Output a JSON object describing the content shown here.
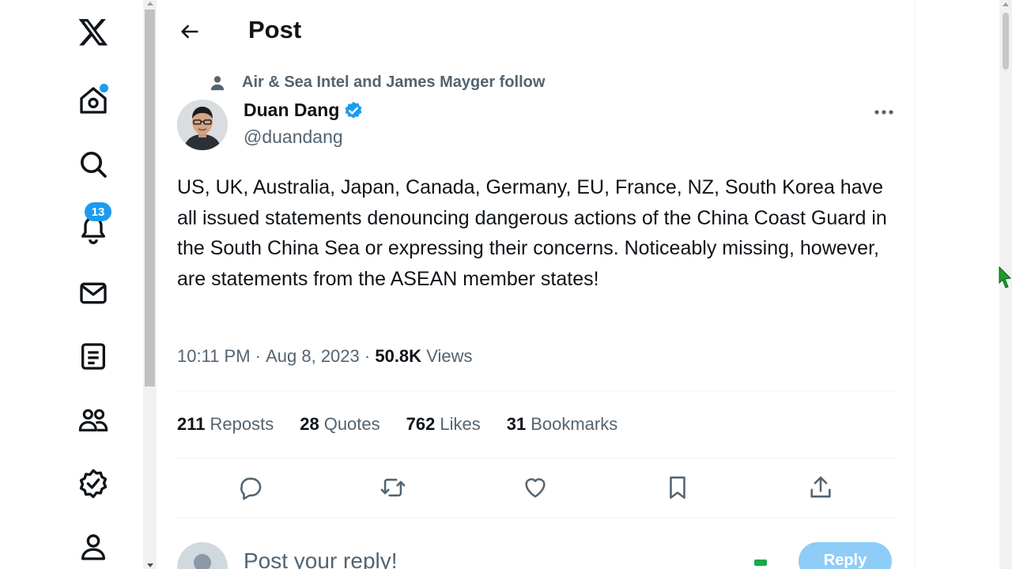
{
  "header": {
    "title": "Post",
    "back_label": "Back"
  },
  "nav": {
    "items": [
      {
        "name": "logo"
      },
      {
        "name": "home"
      },
      {
        "name": "explore"
      },
      {
        "name": "notifications",
        "badge": "13"
      },
      {
        "name": "messages"
      },
      {
        "name": "lists"
      },
      {
        "name": "communities"
      },
      {
        "name": "verified"
      },
      {
        "name": "profile"
      }
    ]
  },
  "post": {
    "social_context": "Air & Sea Intel and James Mayger follow",
    "author": {
      "name": "Duan Dang",
      "handle": "@duandang",
      "verified": true
    },
    "text": "US, UK, Australia, Japan, Canada, Germany, EU, France, NZ, South Korea have all issued statements denouncing dangerous actions of the China Coast Guard in the South China Sea or expressing their concerns. Noticeably missing, however, are statements from the ASEAN member states!",
    "time": "10:11 PM",
    "separator": " · ",
    "date": "Aug 8, 2023",
    "views_count": "50.8K",
    "views_label": "Views",
    "stats": [
      {
        "count": "211",
        "label": "Reposts"
      },
      {
        "count": "28",
        "label": "Quotes"
      },
      {
        "count": "762",
        "label": "Likes"
      },
      {
        "count": "31",
        "label": "Bookmarks"
      }
    ]
  },
  "reply": {
    "placeholder": "Post your reply!",
    "button_label": "Reply"
  },
  "colors": {
    "accent": "#1d9bf0",
    "secondary_text": "#536471",
    "primary_text": "#0f1419"
  }
}
